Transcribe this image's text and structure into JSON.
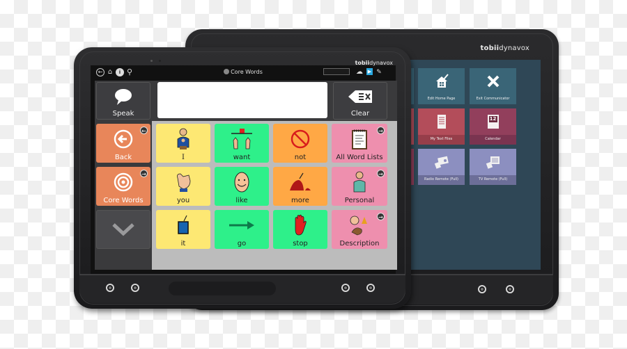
{
  "back_device": {
    "brand_bold": "tobii",
    "brand_regular": "dynavox",
    "tiles": [
      {
        "label": "Edit Home Page",
        "icon": "house-pencil-icon",
        "color": "#3a6577",
        "bar": "#3a6577"
      },
      {
        "label": "Exit Communicator",
        "icon": "x-icon",
        "color": "#3a6577",
        "bar": "#3a6577"
      },
      {
        "label": "My Text Files",
        "icon": "notebook-icon",
        "color": "#b34d5a",
        "bar": "#963e4a"
      },
      {
        "label": "Calendar",
        "icon": "calendar-icon",
        "color": "#923f5c",
        "bar": "#7a3450"
      },
      {
        "label": "Radio Remote (Full)",
        "icon": "radio-remote-icon",
        "color": "#8c8fc0",
        "bar": "#6c6e98"
      },
      {
        "label": "TV Remote (Full)",
        "icon": "tv-remote-icon",
        "color": "#8c8fc0",
        "bar": "#6c6e98"
      }
    ],
    "calendar_day": "12"
  },
  "front_device": {
    "brand_bold": "tobii",
    "brand_regular": "dynavox",
    "page_title": "Core Words",
    "speak_label": "Speak",
    "clear_label": "Clear",
    "message_text": "",
    "left_column": [
      {
        "label": "Back",
        "icon": "back-arrow-icon"
      },
      {
        "label": "Core Words",
        "icon": "target-icon"
      }
    ],
    "scroll_down_icon": "chevron-down-icon",
    "grid": [
      {
        "label": "I",
        "icon": "person-self-icon",
        "color": "yellow"
      },
      {
        "label": "want",
        "icon": "want-hands-icon",
        "color": "green"
      },
      {
        "label": "not",
        "icon": "prohibited-icon",
        "color": "amber"
      },
      {
        "label": "All Word Lists",
        "icon": "notepad-icon",
        "color": "pink",
        "link": true
      },
      {
        "label": "you",
        "icon": "pointing-hand-icon",
        "color": "yellow"
      },
      {
        "label": "like",
        "icon": "smiling-face-icon",
        "color": "green"
      },
      {
        "label": "more",
        "icon": "berries-pile-icon",
        "color": "amber"
      },
      {
        "label": "Personal",
        "icon": "person-icon",
        "color": "pink",
        "link": true
      },
      {
        "label": "it",
        "icon": "blue-square-icon",
        "color": "yellow"
      },
      {
        "label": "go",
        "icon": "arrow-right-icon",
        "color": "green"
      },
      {
        "label": "stop",
        "icon": "stop-hand-icon",
        "color": "amber"
      },
      {
        "label": "Description",
        "icon": "description-icon",
        "color": "pink",
        "link": true
      }
    ]
  }
}
